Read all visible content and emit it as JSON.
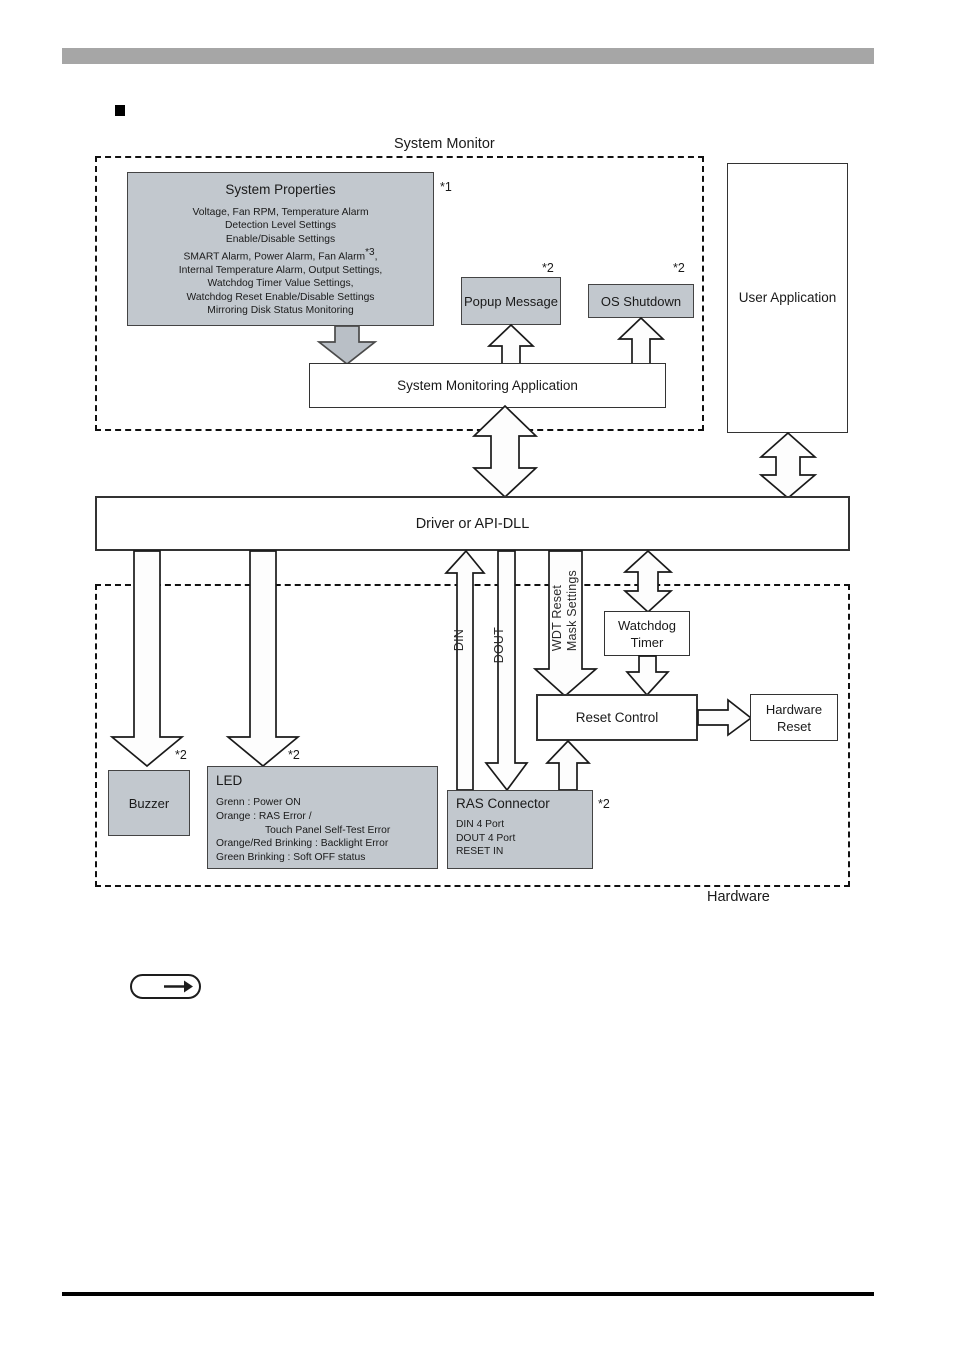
{
  "page": {
    "header_bar_color": "#a6a6a6",
    "box_fill_gray": "#c2c8ce"
  },
  "regions": {
    "system_monitor_label": "System Monitor",
    "hardware_label": "Hardware"
  },
  "system_properties": {
    "title": "System Properties",
    "note": "*1",
    "lines": [
      "Voltage, Fan RPM, Temperature Alarm",
      "Detection Level Settings",
      "Enable/Disable Settings",
      "SMART Alarm, Power Alarm, Fan Alarm",
      "Internal Temperature Alarm, Output Settings,",
      "Watchdog Timer Value Settings,",
      "Watchdog Reset Enable/Disable Settings",
      "Mirroring Disk Status Monitoring"
    ],
    "inline_note": "*3",
    "inline_note_trailer": ","
  },
  "boxes": {
    "popup_message": "Popup Message",
    "popup_message_note": "*2",
    "os_shutdown": "OS Shutdown",
    "os_shutdown_note": "*2",
    "system_monitoring_application": "System Monitoring Application",
    "user_application": "User Application",
    "driver_api_dll": "Driver or API-DLL",
    "watchdog_timer": "Watchdog Timer",
    "reset_control": "Reset Control",
    "hardware_reset": "Hardware Reset",
    "buzzer": "Buzzer",
    "buzzer_note": "*2"
  },
  "led": {
    "title": "LED",
    "note": "*2",
    "lines": [
      "Grenn : Power ON",
      "Orange : RAS Error /",
      "Touch Panel Self-Test Error",
      "Orange/Red Brinking : Backlight Error",
      "Green Brinking : Soft OFF status"
    ]
  },
  "ras_connector": {
    "title": "RAS Connector",
    "note": "*2",
    "lines": [
      "DIN 4 Port",
      "DOUT 4 Port",
      "RESET IN"
    ]
  },
  "signal_labels": {
    "din": "DIN",
    "dout": "DOUT",
    "wdt_reset_line1": "WDT Reset",
    "wdt_reset_line2": "Mask Settings"
  },
  "legend": {
    "reference_arrow_icon": "right-arrow-icon"
  }
}
